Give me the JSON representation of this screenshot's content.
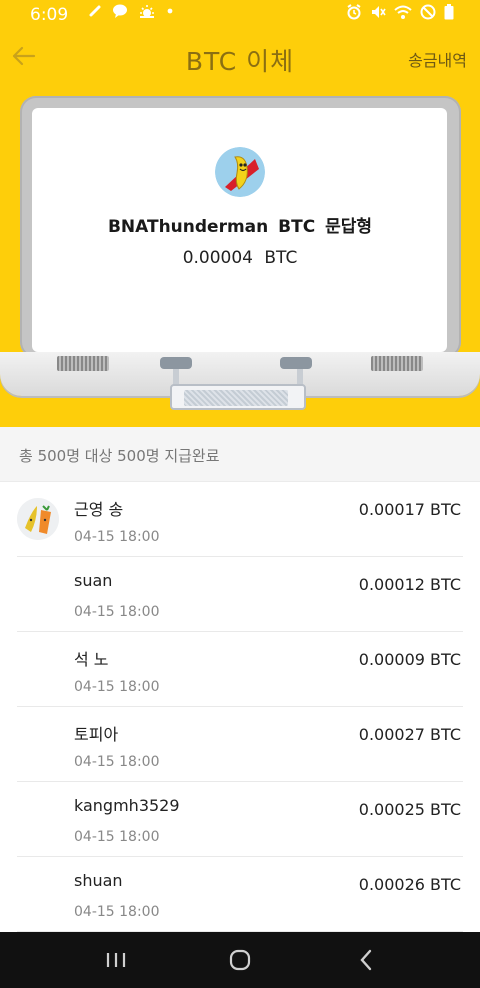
{
  "status_bar": {
    "time": "6:09",
    "left_icons": [
      "link-icon",
      "chat-icon",
      "weather-icon",
      "dot-icon"
    ],
    "right_icons": [
      "alarm-icon",
      "mute-icon",
      "wifi-icon",
      "dnd-icon",
      "battery-icon"
    ]
  },
  "header": {
    "title": "BTC 이체",
    "history_link": "송금내역"
  },
  "card": {
    "sender": "BNAThunderman BTC 문답형",
    "amount": "0.00004 BTC"
  },
  "summary": "총 500명 대상 500명 지급완료",
  "transactions": [
    {
      "name": "근영 송",
      "time": "04-15 18:00",
      "amount": "0.00017 BTC",
      "has_avatar": true
    },
    {
      "name": "suan",
      "time": "04-15 18:00",
      "amount": "0.00012 BTC",
      "has_avatar": false
    },
    {
      "name": "석 노",
      "time": "04-15 18:00",
      "amount": "0.00009 BTC",
      "has_avatar": false
    },
    {
      "name": "토피아",
      "time": "04-15 18:00",
      "amount": "0.00027 BTC",
      "has_avatar": false
    },
    {
      "name": "kangmh3529",
      "time": "04-15 18:00",
      "amount": "0.00025 BTC",
      "has_avatar": false
    },
    {
      "name": "shuan",
      "time": "04-15 18:00",
      "amount": "0.00026 BTC",
      "has_avatar": false
    }
  ],
  "nav": [
    "recent-apps-icon",
    "home-icon",
    "back-nav-icon"
  ],
  "colors": {
    "accent": "#fece0a",
    "title": "#8b6f12",
    "navbar": "#111111"
  }
}
